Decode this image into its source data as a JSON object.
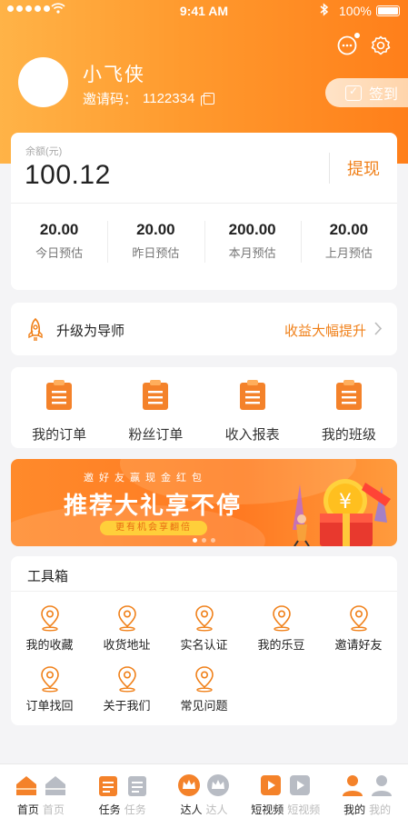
{
  "status_bar": {
    "time": "9:41 AM",
    "battery": "100%"
  },
  "profile": {
    "username": "小飞侠",
    "invite_label": "邀请码：",
    "invite_code": "1122334",
    "signin_label": "签到"
  },
  "balance": {
    "label": "余额(元)",
    "value": "100.12",
    "withdraw_label": "提现",
    "stats": [
      {
        "value": "20.00",
        "label": "今日预估"
      },
      {
        "value": "20.00",
        "label": "昨日预估"
      },
      {
        "value": "200.00",
        "label": "本月预估"
      },
      {
        "value": "20.00",
        "label": "上月预估"
      }
    ]
  },
  "upgrade": {
    "text": "升级为导师",
    "link": "收益大幅提升"
  },
  "orders": [
    {
      "label": "我的订单"
    },
    {
      "label": "粉丝订单"
    },
    {
      "label": "收入报表"
    },
    {
      "label": "我的班级"
    }
  ],
  "banner": {
    "small_text": "邀好友赢现金红包",
    "title": "推荐大礼享不停",
    "pill": "更有机会享翻倍"
  },
  "tools": {
    "title": "工具箱",
    "items": [
      {
        "label": "我的收藏"
      },
      {
        "label": "收货地址"
      },
      {
        "label": "实名认证"
      },
      {
        "label": "我的乐豆"
      },
      {
        "label": "邀请好友"
      },
      {
        "label": "订单找回"
      },
      {
        "label": "关于我们"
      },
      {
        "label": "常见问题"
      }
    ]
  },
  "tabbar": [
    {
      "on": "首页",
      "off": "首页"
    },
    {
      "on": "任务",
      "off": "任务"
    },
    {
      "on": "达人",
      "off": "达人"
    },
    {
      "on": "短视频",
      "off": "短视频"
    },
    {
      "on": "我的",
      "off": "我的"
    }
  ],
  "colors": {
    "accent": "#f08019",
    "header_start": "#ffb347",
    "header_end": "#ff7f1a"
  }
}
